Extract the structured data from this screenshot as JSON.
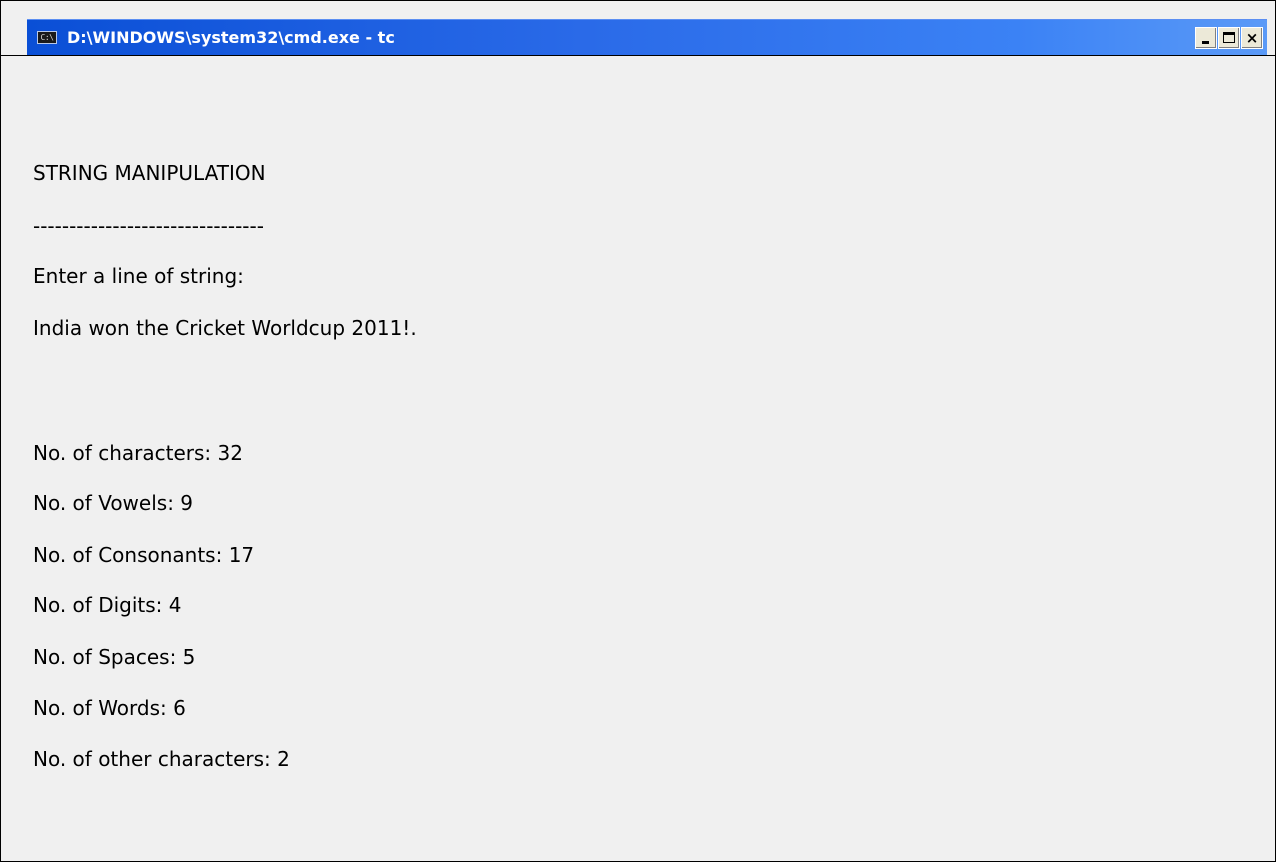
{
  "window": {
    "title": "D:\\WINDOWS\\system32\\cmd.exe - tc",
    "icon": "cmd-icon",
    "icon_glyph": "C:\\",
    "close_glyph": "×"
  },
  "console": {
    "heading": "STRING MANIPULATION",
    "underline": "--------------------------------",
    "prompt": "Enter a line of string:",
    "input": "India won the Cricket Worldcup 2011!.",
    "results": [
      "No. of characters: 32",
      "No. of Vowels: 9",
      "No. of Consonants: 17",
      "No. of Digits: 4",
      "No. of Spaces: 5",
      "No. of Words: 6",
      "No. of other characters: 2"
    ]
  },
  "colors": {
    "titlebar_start": "#0a4fd6",
    "titlebar_end": "#5b9af7",
    "console_bg": "#f0f0f0"
  }
}
